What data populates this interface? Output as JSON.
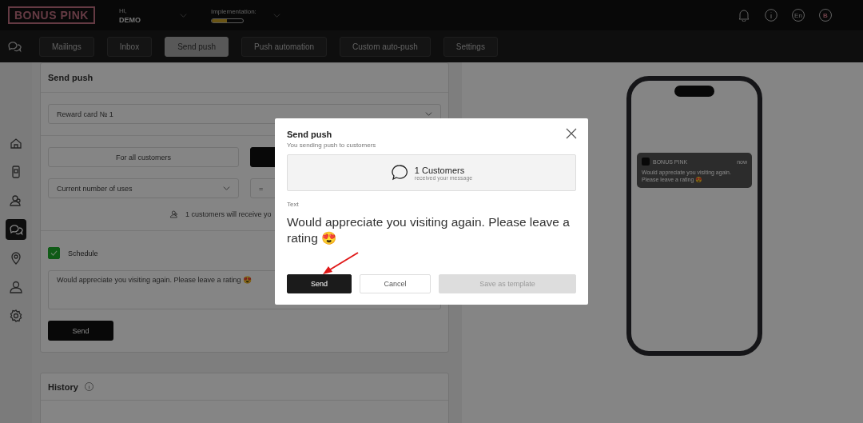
{
  "header": {
    "logo": "BONUS PINK",
    "greeting": "Hi,",
    "user": "DEMO",
    "implementation_label": "Implementation:",
    "implementation": {
      "level": 0.5
    },
    "language": "En",
    "avatar": "B"
  },
  "tabs": [
    {
      "label": "Mailings",
      "selected": false
    },
    {
      "label": "Inbox",
      "selected": false
    },
    {
      "label": "Send push",
      "selected": true
    },
    {
      "label": "Push automation",
      "selected": false
    },
    {
      "label": "Custom auto-push",
      "selected": false
    },
    {
      "label": "Settings",
      "selected": false
    }
  ],
  "sidebar": {
    "items": [
      {
        "kind": "home",
        "selected": false
      },
      {
        "kind": "card",
        "selected": false
      },
      {
        "kind": "customers",
        "selected": false
      },
      {
        "kind": "messages",
        "selected": true
      },
      {
        "kind": "location",
        "selected": false
      },
      {
        "kind": "profile",
        "selected": false
      },
      {
        "kind": "settings",
        "selected": false
      }
    ]
  },
  "send_push": {
    "title": "Send push",
    "card_select": "Reward card № 1",
    "audience": [
      {
        "label": "For all customers",
        "selected": false
      },
      {
        "selected": true
      }
    ],
    "filter_select": "Current number of uses",
    "operator": "=",
    "recipients_note": "1 customers will receive yo",
    "schedule": {
      "label": "Schedule",
      "checked": true
    },
    "message": "Would appreciate you visiting again. Please leave a rating 😍",
    "send_button": "Send"
  },
  "history": {
    "title": "History"
  },
  "phone_preview": {
    "app": "BONUS PINK",
    "time": "now",
    "message": "Would appreciate you visiting again. Please leave a rating 😍"
  },
  "modal": {
    "title": "Send push",
    "subtitle": "You sending push to customers",
    "count": "1 Customers",
    "count_note": "received your message",
    "text_label": "Text",
    "message": "Would appreciate you visiting again. Please leave a rating 😍",
    "buttons": [
      {
        "label": "Send",
        "kind": "primary",
        "disabled": false
      },
      {
        "label": "Cancel",
        "kind": "secondary",
        "disabled": false
      },
      {
        "label": "Save as template",
        "kind": "secondary",
        "disabled": true
      }
    ]
  }
}
